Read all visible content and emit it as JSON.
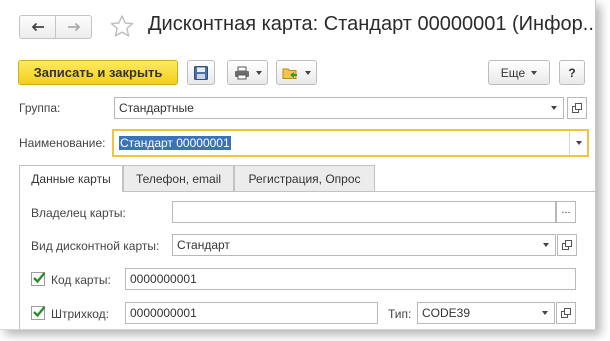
{
  "window": {
    "title": "Дисконтная карта: Стандарт 00000001 (Инфор..."
  },
  "toolbar": {
    "save_close_label": "Записать и закрыть",
    "more_label": "Еще",
    "help_label": "?"
  },
  "form": {
    "group_label": "Группа:",
    "group_value": "Стандартные",
    "name_label": "Наименование:",
    "name_value": "Стандарт 00000001"
  },
  "tabs": [
    {
      "label": "Данные карты",
      "active": true
    },
    {
      "label": "Телефон, email",
      "active": false
    },
    {
      "label": "Регистрация, Опрос",
      "active": false
    }
  ],
  "card": {
    "owner_label": "Владелец карты:",
    "owner_value": "",
    "owner_button": "...",
    "type_label": "Вид дисконтной карты:",
    "type_value": "Стандарт",
    "code_label": "Код карты:",
    "code_checked": true,
    "code_value": "0000000001",
    "barcode_label": "Штрихкод:",
    "barcode_checked": true,
    "barcode_value": "0000000001",
    "barcode_type_label": "Тип:",
    "barcode_type_value": "CODE39"
  },
  "colors": {
    "primary_button": "#f3cf1b",
    "selection": "#3b73b9",
    "focus_border": "#f3c33f",
    "checkmark": "#2e8b2e"
  }
}
